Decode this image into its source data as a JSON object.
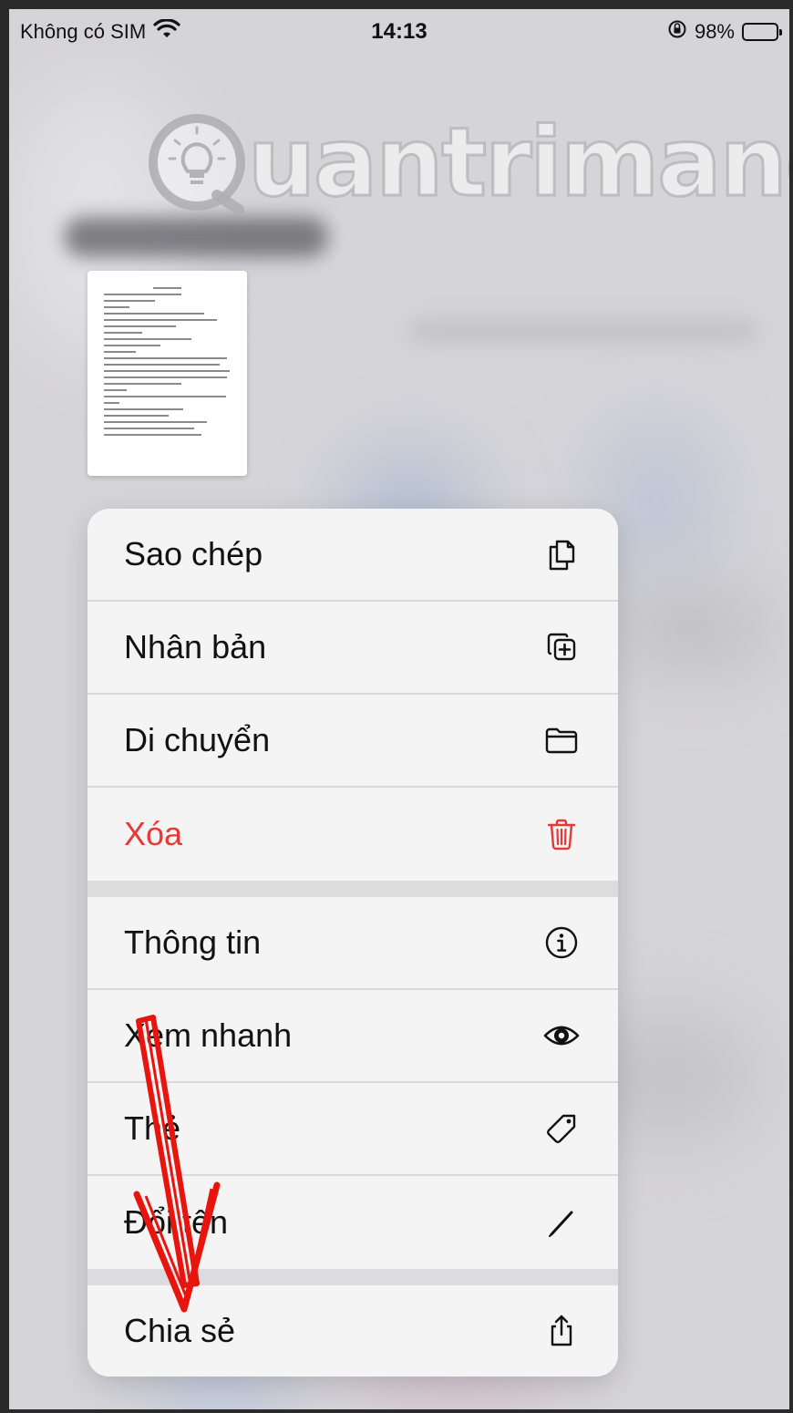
{
  "status_bar": {
    "carrier": "Không có SIM",
    "time": "14:13",
    "battery_percent": "98%"
  },
  "watermark": {
    "text": "uantrimang"
  },
  "menu": {
    "groups": [
      [
        {
          "label": "Sao chép",
          "icon": "copy-icon",
          "danger": false
        },
        {
          "label": "Nhân bản",
          "icon": "duplicate-icon",
          "danger": false
        },
        {
          "label": "Di chuyển",
          "icon": "folder-icon",
          "danger": false
        },
        {
          "label": "Xóa",
          "icon": "trash-icon",
          "danger": true
        }
      ],
      [
        {
          "label": "Thông tin",
          "icon": "info-icon",
          "danger": false
        },
        {
          "label": "Xem nhanh",
          "icon": "eye-icon",
          "danger": false
        },
        {
          "label": "Thẻ",
          "icon": "tag-icon",
          "danger": false
        },
        {
          "label": "Đổi tên",
          "icon": "pencil-icon",
          "danger": false
        }
      ],
      [
        {
          "label": "Chia sẻ",
          "icon": "share-icon",
          "danger": false
        }
      ]
    ]
  },
  "colors": {
    "danger": "#e53935",
    "arrow": "#e8150f"
  }
}
